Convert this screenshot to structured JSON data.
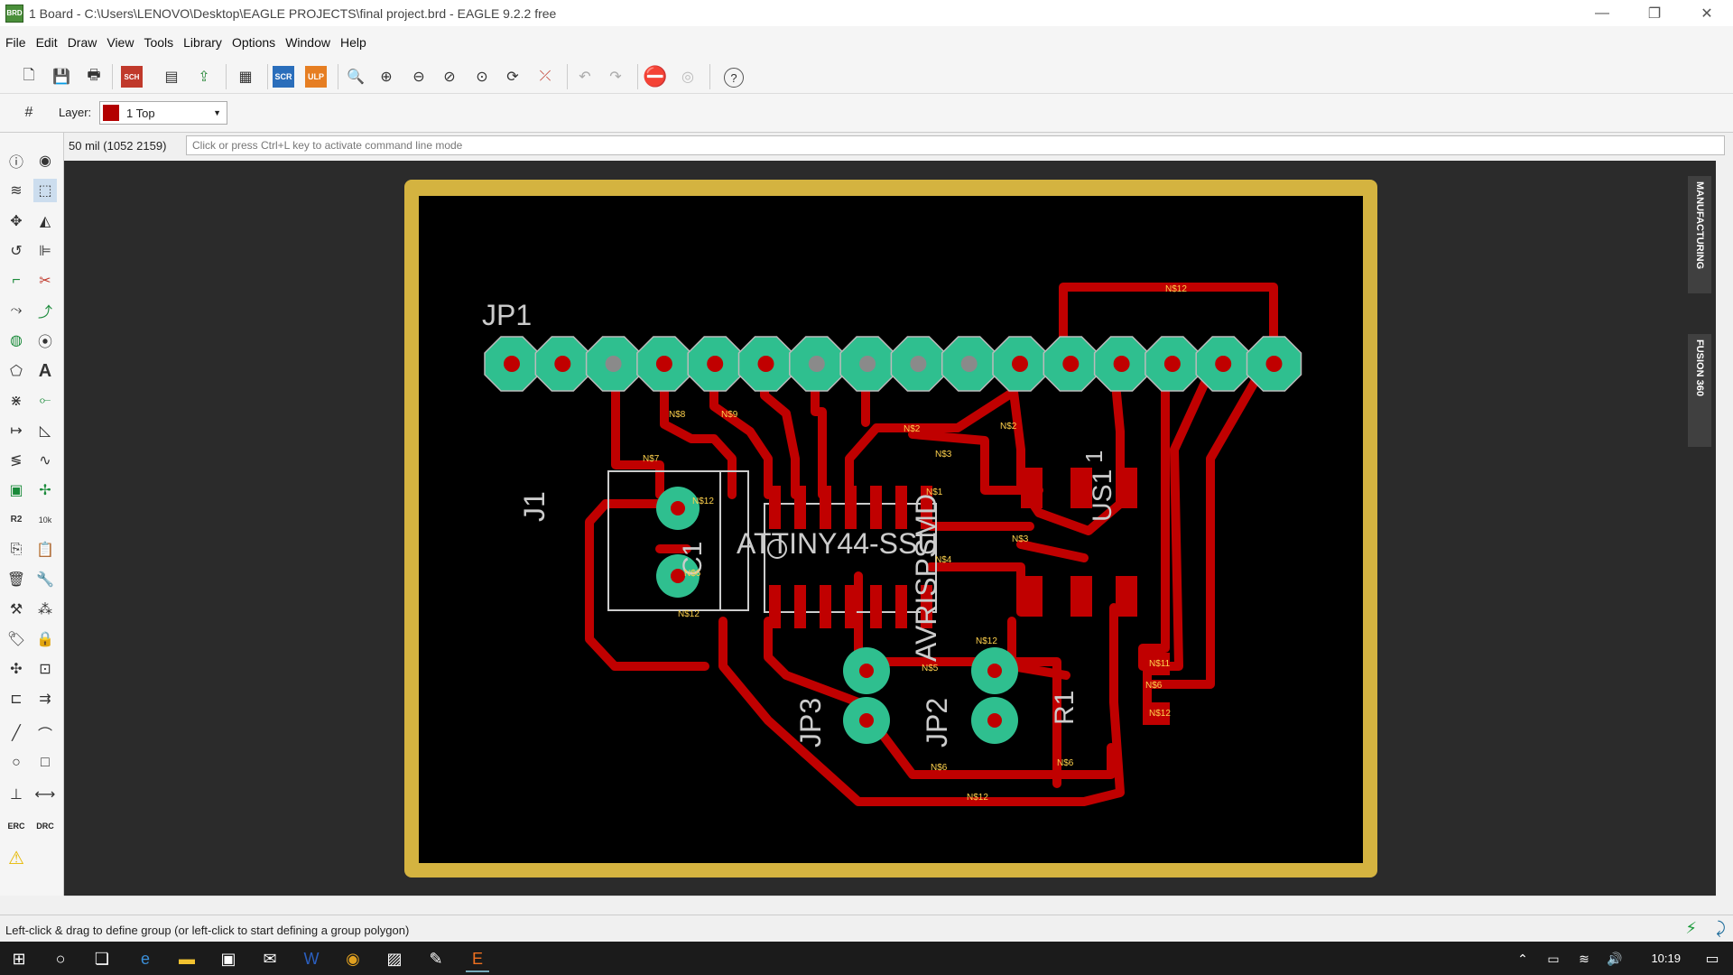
{
  "window": {
    "title": "1 Board - C:\\Users\\LENOVO\\Desktop\\EAGLE PROJECTS\\final project.brd - EAGLE 9.2.2 free",
    "app_icon": "BRD",
    "controls": [
      "—",
      "❐",
      "✕"
    ]
  },
  "menu": [
    "File",
    "Edit",
    "Draw",
    "View",
    "Tools",
    "Library",
    "Options",
    "Window",
    "Help"
  ],
  "toolbar": {
    "scr_label": "SCR",
    "ulp_label": "ULP",
    "sch_label": "SCH",
    "help_label": "?"
  },
  "layer_bar": {
    "label": "Layer:",
    "selected": "1 Top",
    "swatch_color": "#b30000"
  },
  "command": {
    "coordinates": "50 mil (1052 2159)",
    "placeholder": "Click or press Ctrl+L key to activate command line mode"
  },
  "left_tools": {
    "r2_label": "R2",
    "r2_sub": "10k",
    "erc_label": "ERC",
    "drc_label": "DRC"
  },
  "side_tabs": [
    "MANUFACTURING",
    "FUSION 360"
  ],
  "board": {
    "colors": {
      "outline": "#d4b340",
      "background": "#000000",
      "trace": "#c00000",
      "pad": "#2fbf8f",
      "silkscreen": "#cccccc",
      "net_label": "#ffd24d"
    },
    "components": {
      "jp1": "JP1",
      "j1": "J1",
      "c1": "C1",
      "attiny": "ATTINY44-SSU",
      "avrisp": "AVRISPSMD",
      "us1": "US1",
      "jp2": "JP2",
      "jp3": "JP3",
      "r1": "R1",
      "one": "1"
    },
    "net_labels": {
      "n312": "N$12",
      "n37": "N$7",
      "n38": "N$8",
      "n39": "N$9",
      "n310": "N$10",
      "n32": "N$2",
      "n33": "N$3",
      "n34": "N$4",
      "n35": "N$5",
      "n36": "N$6",
      "n31": "N$1",
      "n311": "N$11"
    }
  },
  "status": {
    "message": "Left-click & drag to define group (or left-click to start defining a group polygon)"
  },
  "taskbar": {
    "time": "10:19"
  }
}
